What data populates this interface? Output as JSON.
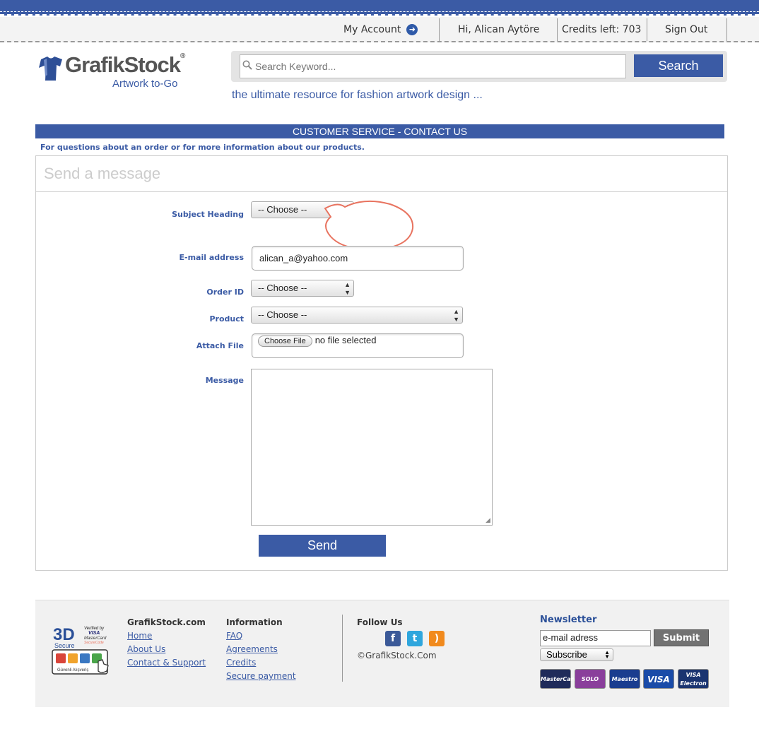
{
  "topbar": {
    "my_account": "My Account",
    "greeting": "Hi, Alican Aytöre",
    "credits": "Credits left: 703",
    "sign_out": "Sign Out"
  },
  "header": {
    "logo_brand": "GrafikStock",
    "logo_tagline": "Artwork to-Go",
    "search_placeholder": "Search Keyword...",
    "search_button": "Search",
    "slogan": "the ultimate resource for fashion artwork design ..."
  },
  "section": {
    "title": "CUSTOMER SERVICE - CONTACT US",
    "subtitle": "For questions about an order or for more information about our products."
  },
  "form": {
    "panel_title": "Send a message",
    "subject_label": "Subject Heading",
    "subject_value": "-- Choose --",
    "email_label": "E-mail address",
    "email_value": "alican_a@yahoo.com",
    "order_label": "Order ID",
    "order_value": "-- Choose --",
    "product_label": "Product",
    "product_value": "-- Choose --",
    "attach_label": "Attach File",
    "choose_file_button": "Choose File",
    "file_status": "no file selected",
    "message_label": "Message",
    "message_value": "",
    "send_button": "Send"
  },
  "footer": {
    "badge": {
      "label_3d": "3D",
      "label_secure": "Secure",
      "verified_visa": "Verified by VISA",
      "mastercard": "MasterCard SecureCode",
      "guvenli": "Güvenli Alışveriş"
    },
    "col1": {
      "heading": "GrafikStock.com",
      "links": [
        "Home",
        "About Us",
        "Contact & Support"
      ]
    },
    "col2": {
      "heading": "Information",
      "links": [
        "FAQ",
        "Agreements",
        "Credits",
        "Secure payment"
      ]
    },
    "follow": {
      "heading": "Follow Us",
      "copyright": "©GrafikStock.Com"
    },
    "newsletter": {
      "heading": "Newsletter",
      "input_value": "e-mail adress",
      "submit": "Submit",
      "select_value": "Subscribe"
    },
    "cards": [
      "MasterCard",
      "SOLO",
      "Maestro",
      "VISA",
      "VISA Electron"
    ]
  },
  "colors": {
    "brand_blue": "#3b5ba5",
    "callout_red": "#e8735f"
  }
}
